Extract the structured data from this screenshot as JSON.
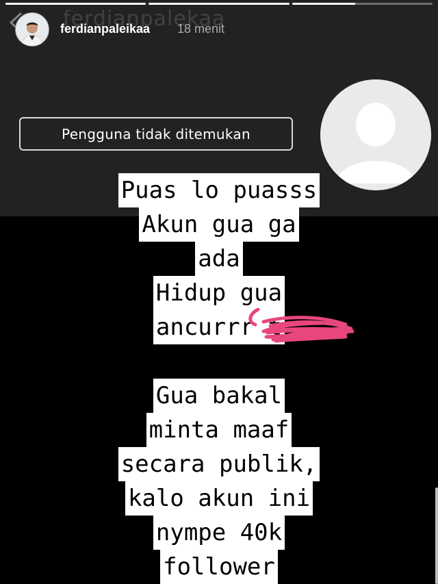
{
  "story": {
    "progress_segments": 3,
    "active_segment_progress": 0.45
  },
  "header": {
    "ghost_text": "ferdianpalekaa",
    "username": "ferdianpaleikaa",
    "timestamp": "18 menit"
  },
  "screenshot": {
    "not_found_text": "Pengguna tidak ditemukan"
  },
  "caption": {
    "lines": [
      "Puas lo puasss",
      "Akun gua ga",
      "ada",
      "Hidup gua",
      "ancurrr t",
      "",
      "Gua bakal",
      "minta maaf",
      "secara publik,",
      "kalo akun ini",
      "nympe 40k",
      "follower"
    ]
  },
  "colors": {
    "scribble": "#e8467f",
    "top_bg": "#222222",
    "caption_bg": "#ffffff"
  },
  "icons": {
    "back": "chevron-left-icon",
    "avatar": "user-avatar",
    "default_profile": "default-profile-icon"
  }
}
